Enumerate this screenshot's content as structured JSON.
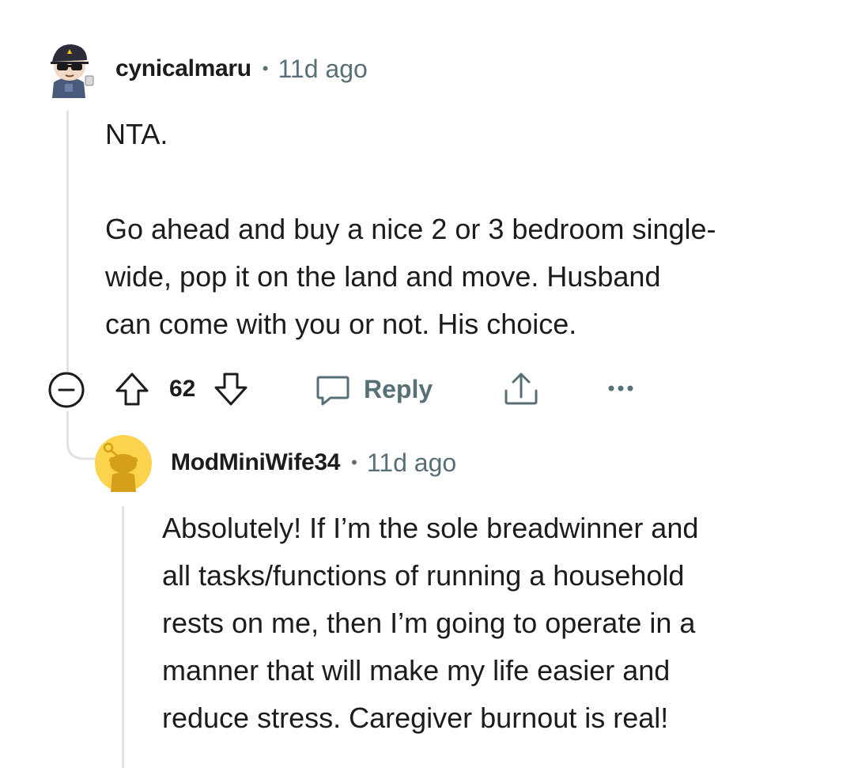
{
  "comment": {
    "username": "cynicalmaru",
    "separator": "•",
    "time": "11d ago",
    "body_lines": [
      "NTA.",
      "Go ahead and buy a nice 2 or 3 bedroom single-",
      "wide, pop it on the land and move. Husband",
      "can come with you or not. His choice."
    ],
    "vote_count": "62",
    "reply_label": "Reply"
  },
  "reply": {
    "username": "ModMiniWife34",
    "separator": "•",
    "time": "11d ago",
    "body_lines": [
      "Absolutely! If I’m the sole breadwinner and",
      "all tasks/functions of running a household",
      "rests on me, then I’m going to operate in a",
      "manner that will make my life easier and",
      "reduce stress. Caregiver burnout is real!"
    ]
  },
  "icons": {
    "collapse": "collapse-minus-icon",
    "upvote": "upvote-arrow-icon",
    "downvote": "downvote-arrow-icon",
    "reply": "speech-bubble-icon",
    "share": "share-icon",
    "more": "more-options-icon",
    "avatar_reply_color": "#fcd34d"
  }
}
